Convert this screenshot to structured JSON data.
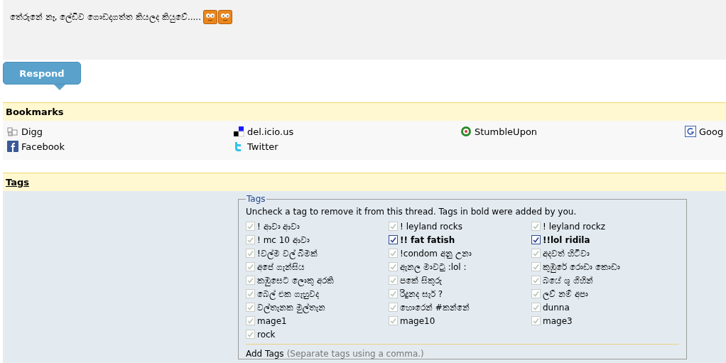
{
  "post": {
    "message": "තේරුනේ නෑ, ලේඩිව ගොඩදාගත්ත කියලද කියුවේ.....",
    "smilies": [
      {
        "kind": "smiley"
      },
      {
        "kind": "smiley"
      }
    ]
  },
  "respond_button": "Respond",
  "bookmarks": {
    "title": "Bookmarks",
    "links": [
      {
        "label": "Digg",
        "kind": "digg"
      },
      {
        "label": "del.icio.us",
        "kind": "delicious"
      },
      {
        "label": "StumbleUpon",
        "kind": "stumble"
      },
      {
        "label": "Goog",
        "kind": "google"
      },
      {
        "label": "Facebook",
        "kind": "facebook"
      },
      {
        "label": "Twitter",
        "kind": "twitter"
      }
    ]
  },
  "tags_section": {
    "title": "Tags",
    "legend": "Tags",
    "instructions": "Uncheck a tag to remove it from this thread. Tags in bold were added by you.",
    "tags": [
      {
        "label": "! ආවා ආවා",
        "checked": true,
        "mine": false
      },
      {
        "label": "! leyland rocks",
        "checked": true,
        "mine": false
      },
      {
        "label": "! leyland rockz",
        "checked": true,
        "mine": false
      },
      {
        "label": "! mc 10 ආවා",
        "checked": true,
        "mine": false
      },
      {
        "label": "!! fat fatish",
        "checked": true,
        "mine": true
      },
      {
        "label": "!!lol ridila",
        "checked": true,
        "mine": true
      },
      {
        "label": "!වල්ම වල් බීමක්",
        "checked": true,
        "mine": false
      },
      {
        "label": "!condom අනු උනා",
        "checked": true,
        "mine": false
      },
      {
        "label": "අදවත් හිටිවා",
        "checked": true,
        "mine": false
      },
      {
        "label": "අපේ ගැන්සිය",
        "checked": true,
        "mine": false
      },
      {
        "label": "ඇනල මාවටු :lol :",
        "checked": true,
        "mine": false
      },
      {
        "label": "කුඹුරේ රොඩා කොඩා",
        "checked": true,
        "mine": false
      },
      {
        "label": "කඹුසෙට ලොකු අරකි",
        "checked": true,
        "mine": false
      },
      {
        "label": "පකේ සිකුරු",
        "checked": true,
        "mine": false
      },
      {
        "label": "බයේ ශු ගිහින්",
        "checked": true,
        "mine": false
      },
      {
        "label": "බෙල් එක ගැහුවද",
        "checked": true,
        "mine": false
      },
      {
        "label": "රිදුනද සැර් ?",
        "checked": true,
        "mine": false
      },
      {
        "label": "ලව් නම් අපා",
        "checked": true,
        "mine": false
      },
      {
        "label": "වල්තැනක මුල්තැන",
        "checked": true,
        "mine": false
      },
      {
        "label": "හොරෙන් #කන්නේ",
        "checked": true,
        "mine": false
      },
      {
        "label": "dunna",
        "checked": true,
        "mine": false
      },
      {
        "label": "mage1",
        "checked": true,
        "mine": false
      },
      {
        "label": "mage10",
        "checked": true,
        "mine": false
      },
      {
        "label": "mage3",
        "checked": true,
        "mine": false
      },
      {
        "label": "rock",
        "checked": true,
        "mine": false
      }
    ],
    "add_tags_label": "Add Tags",
    "add_tags_hint": "(Separate tags using a comma.)"
  }
}
